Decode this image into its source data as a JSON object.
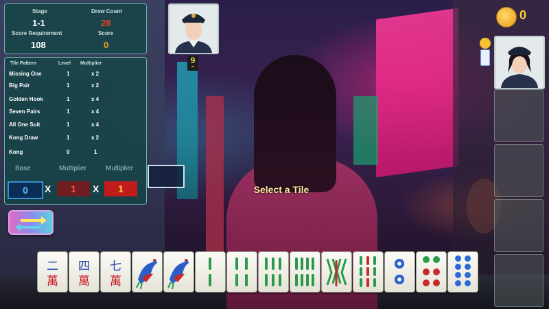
{
  "stats": {
    "stage_label": "Stage",
    "stage_value": "1-1",
    "draw_label": "Draw Count",
    "draw_value": "28",
    "req_label": "Score Requirement",
    "req_value": "108",
    "score_label": "Score",
    "score_value": "0"
  },
  "patterns": {
    "header": {
      "pattern": "Tile Pattern",
      "level": "Level",
      "multiplier": "Multiplier"
    },
    "rows": [
      {
        "name": "Missing One",
        "level": "1",
        "mult": "x 2"
      },
      {
        "name": "Big Pair",
        "level": "1",
        "mult": "x 2"
      },
      {
        "name": "Golden Hook",
        "level": "1",
        "mult": "x 4"
      },
      {
        "name": "Seven Pairs",
        "level": "1",
        "mult": "x 4"
      },
      {
        "name": "All One Suit",
        "level": "1",
        "mult": "x 4"
      },
      {
        "name": "Kong Draw",
        "level": "1",
        "mult": "x 2"
      },
      {
        "name": "Kong",
        "level": "0",
        "mult": "1"
      }
    ],
    "base_label": "Base",
    "mult_label_1": "Multiplier",
    "mult_label_2": "Multiplier",
    "base_value": "0",
    "mult_value_1": "1",
    "mult_value_2": "1",
    "x_sign": "X"
  },
  "opponent_badge": {
    "number": "9"
  },
  "coins": {
    "value": "0"
  },
  "prompt": "Select a Tile",
  "colors": {
    "panel": "#145050",
    "draw_count": "#e0402a",
    "score": "#f0a020",
    "coin": "#ffd23a"
  },
  "hand_tiles": [
    {
      "type": "character",
      "chars": [
        "二",
        "萬"
      ]
    },
    {
      "type": "character",
      "chars": [
        "四",
        "萬"
      ]
    },
    {
      "type": "character",
      "chars": [
        "七",
        "萬"
      ]
    },
    {
      "type": "bird",
      "icon": "bird-icon"
    },
    {
      "type": "bird",
      "icon": "bird-icon"
    },
    {
      "type": "bamboo",
      "count": 2
    },
    {
      "type": "bamboo",
      "count": 4
    },
    {
      "type": "bamboo",
      "count": 6
    },
    {
      "type": "bamboo",
      "count": 8
    },
    {
      "type": "bamboo",
      "count": 9
    },
    {
      "type": "bamboo",
      "count": 9
    },
    {
      "type": "dots",
      "count": 2
    },
    {
      "type": "dots",
      "count": 6
    },
    {
      "type": "dots",
      "count": 8
    }
  ]
}
